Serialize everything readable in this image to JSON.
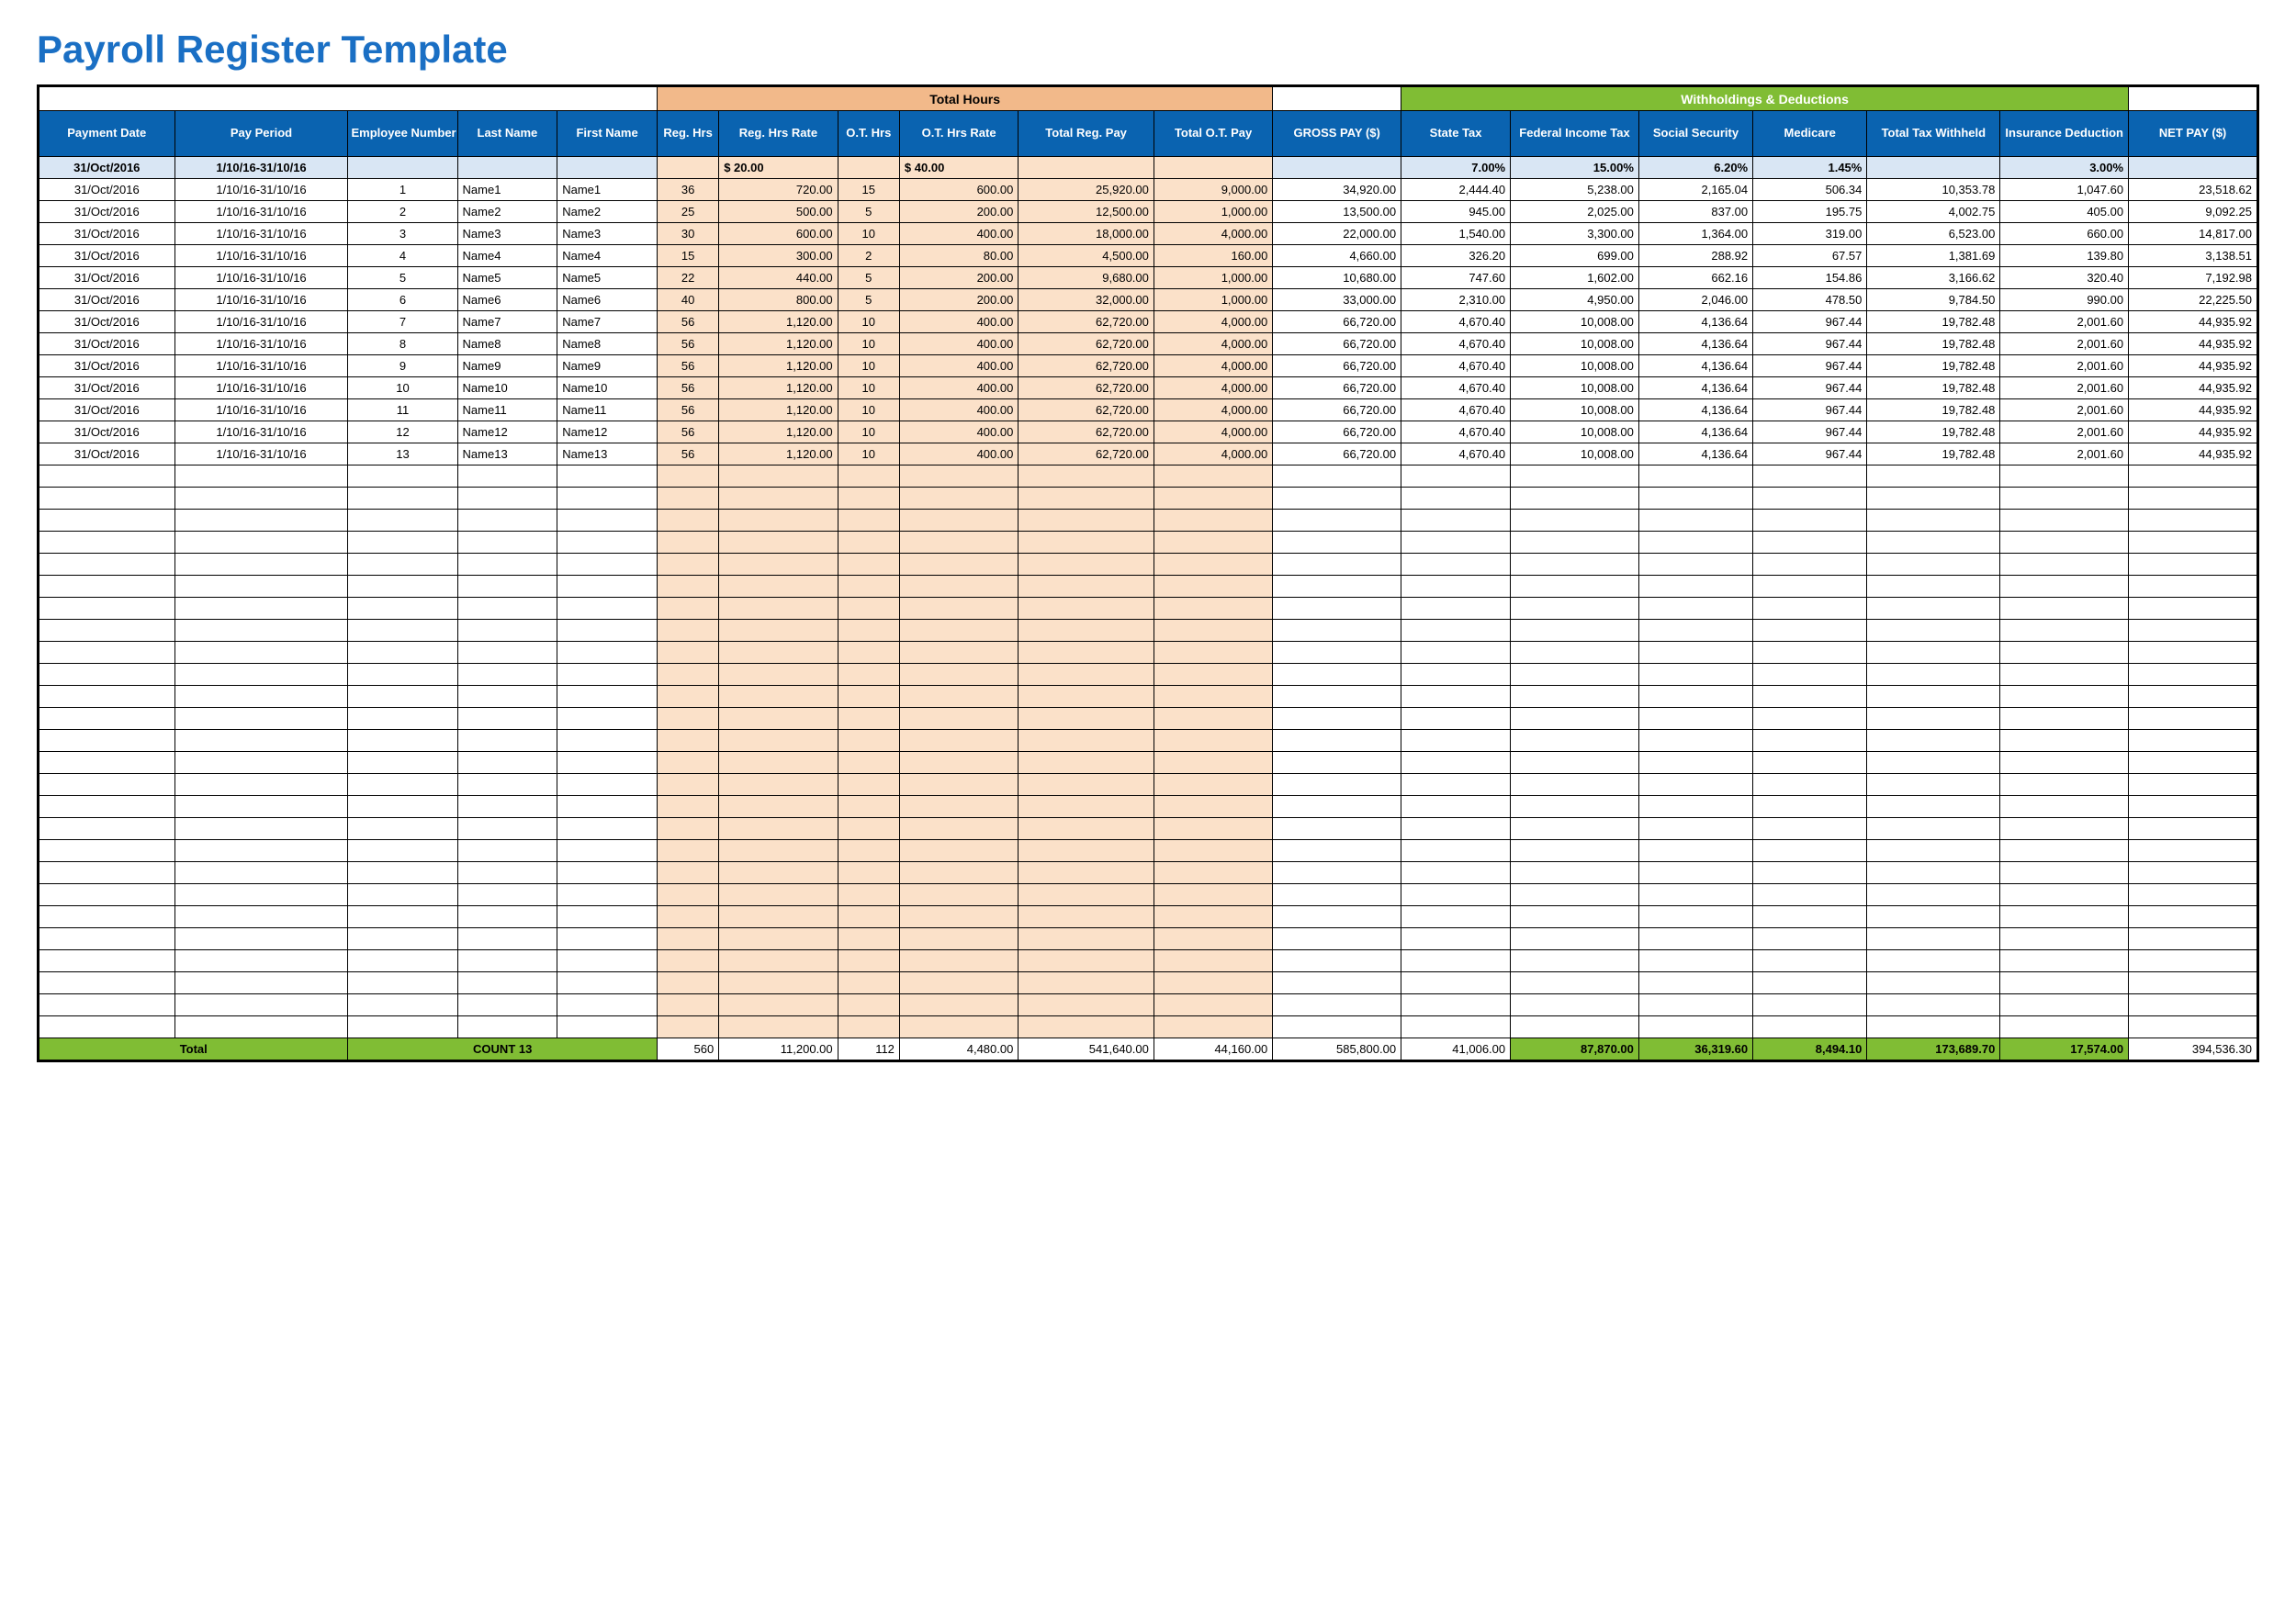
{
  "title": "Payroll Register Template",
  "groupHeaders": {
    "totalHours": "Total Hours",
    "withholdings": "Withholdings & Deductions"
  },
  "columns": [
    "Payment Date",
    "Pay Period",
    "Employee Number",
    "Last Name",
    "First Name",
    "Reg. Hrs",
    "Reg. Hrs Rate",
    "O.T. Hrs",
    "O.T. Hrs Rate",
    "Total Reg. Pay",
    "Total O.T. Pay",
    "GROSS PAY ($)",
    "State Tax",
    "Federal Income Tax",
    "Social Security",
    "Medicare",
    "Total Tax Withheld",
    "Insurance Deduction",
    "NET PAY ($)"
  ],
  "defaults": {
    "paymentDate": "31/Oct/2016",
    "payPeriod": "1/10/16-31/10/16",
    "regRate": "$        20.00",
    "otRate": "$        40.00",
    "stateTax": "7.00%",
    "federalTax": "15.00%",
    "socialSecurity": "6.20%",
    "medicare": "1.45%",
    "insurance": "3.00%"
  },
  "rows": [
    {
      "paymentDate": "31/Oct/2016",
      "payPeriod": "1/10/16-31/10/16",
      "empNo": "1",
      "last": "Name1",
      "first": "Name1",
      "regHrs": "36",
      "regRate": "720.00",
      "otHrs": "15",
      "otRate": "600.00",
      "totalReg": "25,920.00",
      "totalOT": "9,000.00",
      "gross": "34,920.00",
      "state": "2,444.40",
      "federal": "5,238.00",
      "ss": "2,165.04",
      "medicare": "506.34",
      "totalTax": "10,353.78",
      "insurance": "1,047.60",
      "net": "23,518.62"
    },
    {
      "paymentDate": "31/Oct/2016",
      "payPeriod": "1/10/16-31/10/16",
      "empNo": "2",
      "last": "Name2",
      "first": "Name2",
      "regHrs": "25",
      "regRate": "500.00",
      "otHrs": "5",
      "otRate": "200.00",
      "totalReg": "12,500.00",
      "totalOT": "1,000.00",
      "gross": "13,500.00",
      "state": "945.00",
      "federal": "2,025.00",
      "ss": "837.00",
      "medicare": "195.75",
      "totalTax": "4,002.75",
      "insurance": "405.00",
      "net": "9,092.25"
    },
    {
      "paymentDate": "31/Oct/2016",
      "payPeriod": "1/10/16-31/10/16",
      "empNo": "3",
      "last": "Name3",
      "first": "Name3",
      "regHrs": "30",
      "regRate": "600.00",
      "otHrs": "10",
      "otRate": "400.00",
      "totalReg": "18,000.00",
      "totalOT": "4,000.00",
      "gross": "22,000.00",
      "state": "1,540.00",
      "federal": "3,300.00",
      "ss": "1,364.00",
      "medicare": "319.00",
      "totalTax": "6,523.00",
      "insurance": "660.00",
      "net": "14,817.00"
    },
    {
      "paymentDate": "31/Oct/2016",
      "payPeriod": "1/10/16-31/10/16",
      "empNo": "4",
      "last": "Name4",
      "first": "Name4",
      "regHrs": "15",
      "regRate": "300.00",
      "otHrs": "2",
      "otRate": "80.00",
      "totalReg": "4,500.00",
      "totalOT": "160.00",
      "gross": "4,660.00",
      "state": "326.20",
      "federal": "699.00",
      "ss": "288.92",
      "medicare": "67.57",
      "totalTax": "1,381.69",
      "insurance": "139.80",
      "net": "3,138.51"
    },
    {
      "paymentDate": "31/Oct/2016",
      "payPeriod": "1/10/16-31/10/16",
      "empNo": "5",
      "last": "Name5",
      "first": "Name5",
      "regHrs": "22",
      "regRate": "440.00",
      "otHrs": "5",
      "otRate": "200.00",
      "totalReg": "9,680.00",
      "totalOT": "1,000.00",
      "gross": "10,680.00",
      "state": "747.60",
      "federal": "1,602.00",
      "ss": "662.16",
      "medicare": "154.86",
      "totalTax": "3,166.62",
      "insurance": "320.40",
      "net": "7,192.98"
    },
    {
      "paymentDate": "31/Oct/2016",
      "payPeriod": "1/10/16-31/10/16",
      "empNo": "6",
      "last": "Name6",
      "first": "Name6",
      "regHrs": "40",
      "regRate": "800.00",
      "otHrs": "5",
      "otRate": "200.00",
      "totalReg": "32,000.00",
      "totalOT": "1,000.00",
      "gross": "33,000.00",
      "state": "2,310.00",
      "federal": "4,950.00",
      "ss": "2,046.00",
      "medicare": "478.50",
      "totalTax": "9,784.50",
      "insurance": "990.00",
      "net": "22,225.50"
    },
    {
      "paymentDate": "31/Oct/2016",
      "payPeriod": "1/10/16-31/10/16",
      "empNo": "7",
      "last": "Name7",
      "first": "Name7",
      "regHrs": "56",
      "regRate": "1,120.00",
      "otHrs": "10",
      "otRate": "400.00",
      "totalReg": "62,720.00",
      "totalOT": "4,000.00",
      "gross": "66,720.00",
      "state": "4,670.40",
      "federal": "10,008.00",
      "ss": "4,136.64",
      "medicare": "967.44",
      "totalTax": "19,782.48",
      "insurance": "2,001.60",
      "net": "44,935.92"
    },
    {
      "paymentDate": "31/Oct/2016",
      "payPeriod": "1/10/16-31/10/16",
      "empNo": "8",
      "last": "Name8",
      "first": "Name8",
      "regHrs": "56",
      "regRate": "1,120.00",
      "otHrs": "10",
      "otRate": "400.00",
      "totalReg": "62,720.00",
      "totalOT": "4,000.00",
      "gross": "66,720.00",
      "state": "4,670.40",
      "federal": "10,008.00",
      "ss": "4,136.64",
      "medicare": "967.44",
      "totalTax": "19,782.48",
      "insurance": "2,001.60",
      "net": "44,935.92"
    },
    {
      "paymentDate": "31/Oct/2016",
      "payPeriod": "1/10/16-31/10/16",
      "empNo": "9",
      "last": "Name9",
      "first": "Name9",
      "regHrs": "56",
      "regRate": "1,120.00",
      "otHrs": "10",
      "otRate": "400.00",
      "totalReg": "62,720.00",
      "totalOT": "4,000.00",
      "gross": "66,720.00",
      "state": "4,670.40",
      "federal": "10,008.00",
      "ss": "4,136.64",
      "medicare": "967.44",
      "totalTax": "19,782.48",
      "insurance": "2,001.60",
      "net": "44,935.92"
    },
    {
      "paymentDate": "31/Oct/2016",
      "payPeriod": "1/10/16-31/10/16",
      "empNo": "10",
      "last": "Name10",
      "first": "Name10",
      "regHrs": "56",
      "regRate": "1,120.00",
      "otHrs": "10",
      "otRate": "400.00",
      "totalReg": "62,720.00",
      "totalOT": "4,000.00",
      "gross": "66,720.00",
      "state": "4,670.40",
      "federal": "10,008.00",
      "ss": "4,136.64",
      "medicare": "967.44",
      "totalTax": "19,782.48",
      "insurance": "2,001.60",
      "net": "44,935.92"
    },
    {
      "paymentDate": "31/Oct/2016",
      "payPeriod": "1/10/16-31/10/16",
      "empNo": "11",
      "last": "Name11",
      "first": "Name11",
      "regHrs": "56",
      "regRate": "1,120.00",
      "otHrs": "10",
      "otRate": "400.00",
      "totalReg": "62,720.00",
      "totalOT": "4,000.00",
      "gross": "66,720.00",
      "state": "4,670.40",
      "federal": "10,008.00",
      "ss": "4,136.64",
      "medicare": "967.44",
      "totalTax": "19,782.48",
      "insurance": "2,001.60",
      "net": "44,935.92"
    },
    {
      "paymentDate": "31/Oct/2016",
      "payPeriod": "1/10/16-31/10/16",
      "empNo": "12",
      "last": "Name12",
      "first": "Name12",
      "regHrs": "56",
      "regRate": "1,120.00",
      "otHrs": "10",
      "otRate": "400.00",
      "totalReg": "62,720.00",
      "totalOT": "4,000.00",
      "gross": "66,720.00",
      "state": "4,670.40",
      "federal": "10,008.00",
      "ss": "4,136.64",
      "medicare": "967.44",
      "totalTax": "19,782.48",
      "insurance": "2,001.60",
      "net": "44,935.92"
    },
    {
      "paymentDate": "31/Oct/2016",
      "payPeriod": "1/10/16-31/10/16",
      "empNo": "13",
      "last": "Name13",
      "first": "Name13",
      "regHrs": "56",
      "regRate": "1,120.00",
      "otHrs": "10",
      "otRate": "400.00",
      "totalReg": "62,720.00",
      "totalOT": "4,000.00",
      "gross": "66,720.00",
      "state": "4,670.40",
      "federal": "10,008.00",
      "ss": "4,136.64",
      "medicare": "967.44",
      "totalTax": "19,782.48",
      "insurance": "2,001.60",
      "net": "44,935.92"
    }
  ],
  "emptyRowsCount": 26,
  "totals": {
    "label": "Total",
    "count": "COUNT  13",
    "regHrs": "560",
    "regRate": "11,200.00",
    "otHrs": "112",
    "otRate": "4,480.00",
    "totalReg": "541,640.00",
    "totalOT": "44,160.00",
    "gross": "585,800.00",
    "state": "41,006.00",
    "federal": "87,870.00",
    "ss": "36,319.60",
    "medicare": "8,494.10",
    "totalTax": "173,689.70",
    "insurance": "17,574.00",
    "net": "394,536.30"
  }
}
